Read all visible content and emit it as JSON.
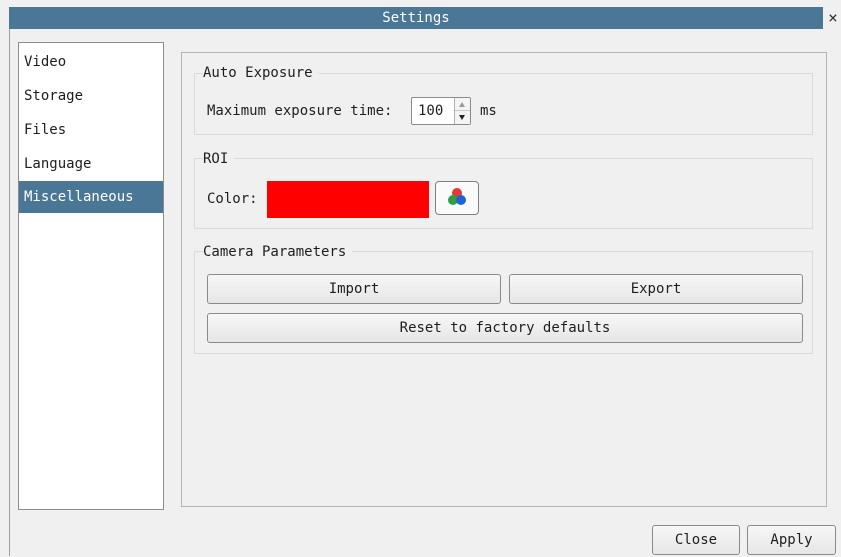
{
  "window": {
    "title": "Settings",
    "close_glyph": "×"
  },
  "sidebar": {
    "items": [
      {
        "label": "Video"
      },
      {
        "label": "Storage"
      },
      {
        "label": "Files"
      },
      {
        "label": "Language"
      },
      {
        "label": "Miscellaneous",
        "selected": true
      }
    ]
  },
  "auto_exposure": {
    "title": "Auto Exposure",
    "max_label": "Maximum exposure time:",
    "value": "100",
    "unit": "ms"
  },
  "roi": {
    "title": "ROI",
    "color_label": "Color:",
    "color": "#ff0000",
    "picker_icon": "color-wheel-icon"
  },
  "camera_parameters": {
    "title": "Camera Parameters",
    "import_label": "Import",
    "export_label": "Export",
    "reset_label": "Reset to factory defaults"
  },
  "footer": {
    "close_label": "Close",
    "apply_label": "Apply"
  },
  "colors": {
    "accent": "#4a7795",
    "background": "#f0f0f0"
  }
}
